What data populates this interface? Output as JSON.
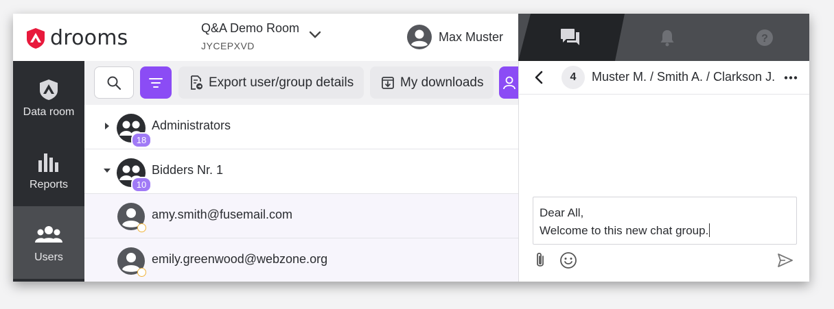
{
  "app": {
    "logo_text": "drooms",
    "brand_color": "#e8193c",
    "accent_color": "#8b4cf5"
  },
  "header": {
    "room_name": "Q&A Demo Room",
    "room_code": "JYCEPXVD",
    "user_name": "Max Muster",
    "icons": [
      "chat-icon",
      "bell-icon",
      "help-icon"
    ]
  },
  "sidebar": {
    "items": [
      {
        "label": "Data room",
        "icon": "data-room-icon",
        "active": false
      },
      {
        "label": "Reports",
        "icon": "bar-chart-icon",
        "active": false
      },
      {
        "label": "Users",
        "icon": "users-icon",
        "active": true
      }
    ]
  },
  "toolbar": {
    "export_label": "Export user/group details",
    "downloads_label": "My downloads"
  },
  "list": {
    "groups": [
      {
        "name": "Administrators",
        "count": "18",
        "expanded": false
      },
      {
        "name": "Bidders Nr. 1",
        "count": "10",
        "expanded": true
      }
    ],
    "members": [
      {
        "email": "amy.smith@fusemail.com"
      },
      {
        "email": "emily.greenwood@webzone.org"
      }
    ]
  },
  "chat": {
    "participant_count": "4",
    "title": "Muster M. / Smith A. / Clarkson J.",
    "message_line1": "Dear All,",
    "message_line2": "Welcome to this new chat group."
  }
}
